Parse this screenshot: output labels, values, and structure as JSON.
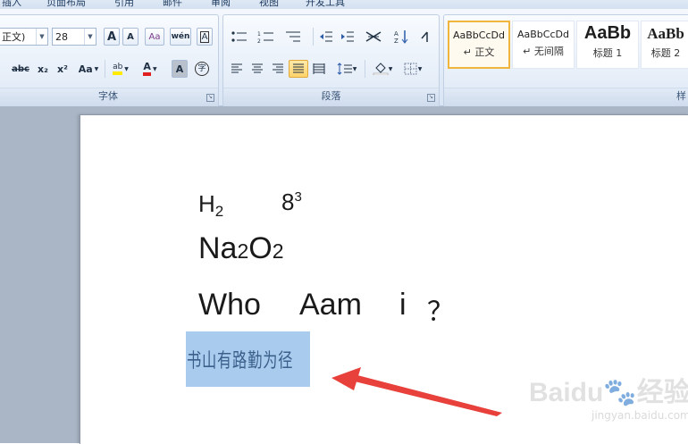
{
  "tabs": [
    "插入",
    "页面布局",
    "引用",
    "邮件",
    "审阅",
    "视图",
    "开发工具"
  ],
  "font_group": {
    "label": "字体",
    "font_name": "正文)",
    "font_size": "28",
    "buttons": [
      "A",
      "A",
      "Aa",
      "wén",
      "A",
      "abc",
      "x₂",
      "x²",
      "Aa",
      "ab",
      "A",
      "A",
      "字"
    ]
  },
  "paragraph_group": {
    "label": "段落"
  },
  "styles_group": {
    "label": "样",
    "items": [
      {
        "sample": "AaBbCcDd",
        "name": "↵ 正文"
      },
      {
        "sample": "AaBbCcDd",
        "name": "↵ 无间隔"
      },
      {
        "sample": "AaBb",
        "name": "标题 1"
      },
      {
        "sample": "AaBb",
        "name": "标题 2"
      }
    ]
  },
  "document": {
    "line1_h": "H",
    "line1_h_sub": "2",
    "line1_n": "8",
    "line1_n_sup": "3",
    "line2_na": "Na",
    "line2_sub1": "2",
    "line2_o": "O",
    "line2_sub2": "2",
    "line3_who": "Who",
    "line3_aam": "Aam",
    "line3_i": "i",
    "line3_q": "？",
    "line4": "书山有路勤为径"
  },
  "annotation": {
    "arrow_color": "#e8403a"
  },
  "watermark": {
    "brand": "Baidu",
    "brand_cn": "经验",
    "url": "jingyan.baidu.com"
  }
}
